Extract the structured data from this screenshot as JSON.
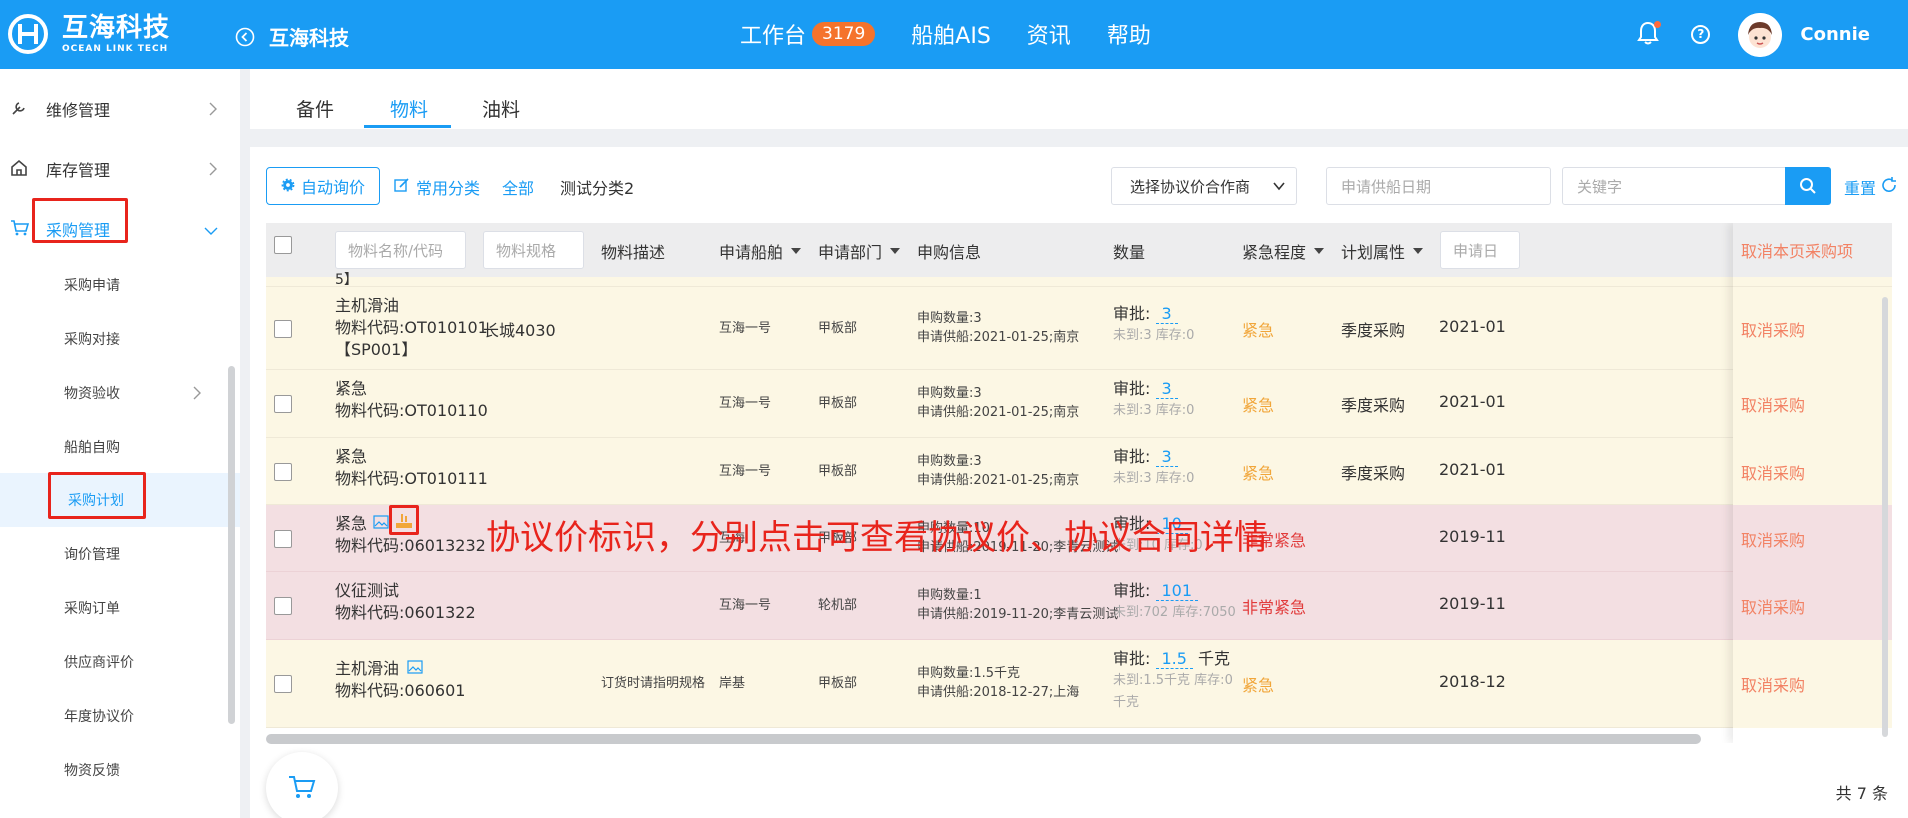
{
  "header": {
    "logo_cn": "互海科技",
    "logo_en": "OCEAN LINK TECH",
    "back_title": "互海科技",
    "nav": [
      {
        "label": "工作台",
        "badge": "3179"
      },
      {
        "label": "船舶AIS"
      },
      {
        "label": "资讯"
      },
      {
        "label": "帮助"
      }
    ],
    "username": "Connie"
  },
  "sidebar": {
    "items": [
      {
        "label": "维修管理",
        "icon": "wrench-icon"
      },
      {
        "label": "库存管理",
        "icon": "home-icon"
      },
      {
        "label": "采购管理",
        "icon": "cart-icon"
      }
    ],
    "sub_items": [
      "采购申请",
      "采购对接",
      "物资验收",
      "船舶自购",
      "采购计划",
      "询价管理",
      "采购订单",
      "供应商评价",
      "年度协议价",
      "物资反馈"
    ]
  },
  "tabs": [
    "备件",
    "物料",
    "油料"
  ],
  "filters": {
    "auto_inquiry": "自动询价",
    "common_category": "常用分类",
    "all": "全部",
    "test_category": "测试分类2",
    "supplier_select": "选择协议价合作商",
    "date_placeholder": "申请供船日期",
    "keyword_placeholder": "关键字",
    "reset": "重置"
  },
  "table": {
    "headers": {
      "name_placeholder": "物料名称/代码",
      "spec_placeholder": "物料规格",
      "description": "物料描述",
      "ship": "申请船舶",
      "dept": "申请部门",
      "info": "申购信息",
      "qty": "数量",
      "urgency": "紧急程度",
      "plan": "计划属性",
      "apply_placeholder": "申请日",
      "cancel_all": "取消本页采购项"
    },
    "partial_top": "5】",
    "rows": [
      {
        "bg": "yellow",
        "name": "主机滑油",
        "code": "物料代码:OT010101",
        "code2": "【SP001】",
        "spec": "长城4030",
        "desc": "",
        "ship": "互海一号",
        "dept": "甲板部",
        "info1": "申购数量:3",
        "info2": "申请供船:2021-01-25;南京",
        "approve_label": "审批:",
        "approve_val": "3",
        "approve_unit": "",
        "stock": "未到:3 库存:0",
        "stock2": "",
        "urgency": "紧急",
        "urgency_class": "urgent",
        "plan": "季度采购",
        "date": "2021-01",
        "cancel": "取消采购"
      },
      {
        "bg": "yellow",
        "name": "紧急",
        "code": "物料代码:OT010110",
        "code2": "",
        "spec": "",
        "desc": "",
        "ship": "互海一号",
        "dept": "甲板部",
        "info1": "申购数量:3",
        "info2": "申请供船:2021-01-25;南京",
        "approve_label": "审批:",
        "approve_val": "3",
        "approve_unit": "",
        "stock": "未到:3 库存:0",
        "stock2": "",
        "urgency": "紧急",
        "urgency_class": "urgent",
        "plan": "季度采购",
        "date": "2021-01",
        "cancel": "取消采购"
      },
      {
        "bg": "yellow",
        "name": "紧急",
        "code": "物料代码:OT010111",
        "code2": "",
        "spec": "",
        "desc": "",
        "ship": "互海一号",
        "dept": "甲板部",
        "info1": "申购数量:3",
        "info2": "申请供船:2021-01-25;南京",
        "approve_label": "审批:",
        "approve_val": "3",
        "approve_unit": "",
        "stock": "未到:3 库存:0",
        "stock2": "",
        "urgency": "紧急",
        "urgency_class": "urgent",
        "plan": "季度采购",
        "date": "2021-01",
        "cancel": "取消采购"
      },
      {
        "bg": "pink",
        "name": "紧急",
        "code": "物料代码:06013232",
        "code2": "",
        "spec": "",
        "desc": "",
        "ship": "互海",
        "dept": "甲板部",
        "info1": "申购数量:10",
        "info2": "申请供船:2019-11-20;李青云测试",
        "approve_label": "审批:",
        "approve_val": "10",
        "approve_unit": "",
        "stock": "未到:10 库存:0",
        "stock2": "",
        "urgency": "非常紧急",
        "urgency_class": "very-urgent",
        "plan": "",
        "date": "2019-11",
        "cancel": "取消采购"
      },
      {
        "bg": "pink",
        "name": "仪征测试",
        "code": "物料代码:0601322",
        "code2": "",
        "spec": "",
        "desc": "",
        "ship": "互海一号",
        "dept": "轮机部",
        "info1": "申购数量:1",
        "info2": "申请供船:2019-11-20;李青云测试",
        "approve_label": "审批:",
        "approve_val": "101",
        "approve_unit": "",
        "stock": "未到:702 库存:7050",
        "stock2": "",
        "urgency": "非常紧急",
        "urgency_class": "very-urgent",
        "plan": "",
        "date": "2019-11",
        "cancel": "取消采购"
      },
      {
        "bg": "yellow",
        "name": "主机滑油",
        "code": "物料代码:060601",
        "code2": "",
        "spec": "",
        "desc": "订货时请指明规格",
        "ship": "岸基",
        "dept": "甲板部",
        "info1": "申购数量:1.5千克",
        "info2": "申请供船:2018-12-27;上海",
        "approve_label": "审批:",
        "approve_val": "1.5",
        "approve_unit": "千克",
        "stock": "未到:1.5千克 库存:0",
        "stock2": "千克",
        "urgency": "紧急",
        "urgency_class": "urgent",
        "plan": "",
        "date": "2018-12",
        "cancel": "取消采购"
      }
    ]
  },
  "annotation": "协议价标识，分别点击可查看协议价、协议合同详情",
  "footer": {
    "total": "共 7 条"
  }
}
